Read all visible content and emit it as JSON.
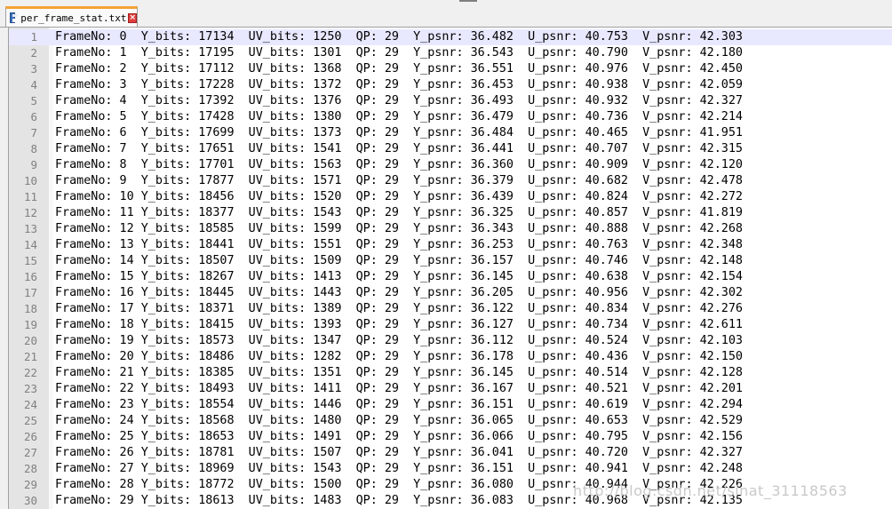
{
  "tab": {
    "filename": "per_frame_stat.txt",
    "close_symbol": "×"
  },
  "editor": {
    "current_line": 1,
    "lines": [
      "FrameNo: 0  Y_bits: 17134  UV_bits: 1250  QP: 29  Y_psnr: 36.482  U_psnr: 40.753  V_psnr: 42.303",
      "FrameNo: 1  Y_bits: 17195  UV_bits: 1301  QP: 29  Y_psnr: 36.543  U_psnr: 40.790  V_psnr: 42.180",
      "FrameNo: 2  Y_bits: 17112  UV_bits: 1368  QP: 29  Y_psnr: 36.551  U_psnr: 40.976  V_psnr: 42.450",
      "FrameNo: 3  Y_bits: 17228  UV_bits: 1372  QP: 29  Y_psnr: 36.453  U_psnr: 40.938  V_psnr: 42.059",
      "FrameNo: 4  Y_bits: 17392  UV_bits: 1376  QP: 29  Y_psnr: 36.493  U_psnr: 40.932  V_psnr: 42.327",
      "FrameNo: 5  Y_bits: 17428  UV_bits: 1380  QP: 29  Y_psnr: 36.479  U_psnr: 40.736  V_psnr: 42.214",
      "FrameNo: 6  Y_bits: 17699  UV_bits: 1373  QP: 29  Y_psnr: 36.484  U_psnr: 40.465  V_psnr: 41.951",
      "FrameNo: 7  Y_bits: 17651  UV_bits: 1541  QP: 29  Y_psnr: 36.441  U_psnr: 40.707  V_psnr: 42.315",
      "FrameNo: 8  Y_bits: 17701  UV_bits: 1563  QP: 29  Y_psnr: 36.360  U_psnr: 40.909  V_psnr: 42.120",
      "FrameNo: 9  Y_bits: 17877  UV_bits: 1571  QP: 29  Y_psnr: 36.379  U_psnr: 40.682  V_psnr: 42.478",
      "FrameNo: 10 Y_bits: 18456  UV_bits: 1520  QP: 29  Y_psnr: 36.439  U_psnr: 40.824  V_psnr: 42.272",
      "FrameNo: 11 Y_bits: 18377  UV_bits: 1543  QP: 29  Y_psnr: 36.325  U_psnr: 40.857  V_psnr: 41.819",
      "FrameNo: 12 Y_bits: 18585  UV_bits: 1599  QP: 29  Y_psnr: 36.343  U_psnr: 40.888  V_psnr: 42.268",
      "FrameNo: 13 Y_bits: 18441  UV_bits: 1551  QP: 29  Y_psnr: 36.253  U_psnr: 40.763  V_psnr: 42.348",
      "FrameNo: 14 Y_bits: 18507  UV_bits: 1509  QP: 29  Y_psnr: 36.157  U_psnr: 40.746  V_psnr: 42.148",
      "FrameNo: 15 Y_bits: 18267  UV_bits: 1413  QP: 29  Y_psnr: 36.145  U_psnr: 40.638  V_psnr: 42.154",
      "FrameNo: 16 Y_bits: 18445  UV_bits: 1443  QP: 29  Y_psnr: 36.205  U_psnr: 40.956  V_psnr: 42.302",
      "FrameNo: 17 Y_bits: 18371  UV_bits: 1389  QP: 29  Y_psnr: 36.122  U_psnr: 40.834  V_psnr: 42.276",
      "FrameNo: 18 Y_bits: 18415  UV_bits: 1393  QP: 29  Y_psnr: 36.127  U_psnr: 40.734  V_psnr: 42.611",
      "FrameNo: 19 Y_bits: 18573  UV_bits: 1347  QP: 29  Y_psnr: 36.112  U_psnr: 40.524  V_psnr: 42.103",
      "FrameNo: 20 Y_bits: 18486  UV_bits: 1282  QP: 29  Y_psnr: 36.178  U_psnr: 40.436  V_psnr: 42.150",
      "FrameNo: 21 Y_bits: 18385  UV_bits: 1351  QP: 29  Y_psnr: 36.145  U_psnr: 40.514  V_psnr: 42.128",
      "FrameNo: 22 Y_bits: 18493  UV_bits: 1411  QP: 29  Y_psnr: 36.167  U_psnr: 40.521  V_psnr: 42.201",
      "FrameNo: 23 Y_bits: 18554  UV_bits: 1446  QP: 29  Y_psnr: 36.151  U_psnr: 40.619  V_psnr: 42.294",
      "FrameNo: 24 Y_bits: 18568  UV_bits: 1480  QP: 29  Y_psnr: 36.065  U_psnr: 40.653  V_psnr: 42.529",
      "FrameNo: 25 Y_bits: 18653  UV_bits: 1491  QP: 29  Y_psnr: 36.066  U_psnr: 40.795  V_psnr: 42.156",
      "FrameNo: 26 Y_bits: 18781  UV_bits: 1507  QP: 29  Y_psnr: 36.041  U_psnr: 40.720  V_psnr: 42.327",
      "FrameNo: 27 Y_bits: 18969  UV_bits: 1543  QP: 29  Y_psnr: 36.151  U_psnr: 40.941  V_psnr: 42.248",
      "FrameNo: 28 Y_bits: 18772  UV_bits: 1500  QP: 29  Y_psnr: 36.080  U_psnr: 40.944  V_psnr: 42.226",
      "FrameNo: 29 Y_bits: 18613  UV_bits: 1483  QP: 29  Y_psnr: 36.083  U_psnr: 40.968  V_psnr: 42.135"
    ]
  },
  "watermark": "http://blog.csdn.net/sinat_31118563"
}
